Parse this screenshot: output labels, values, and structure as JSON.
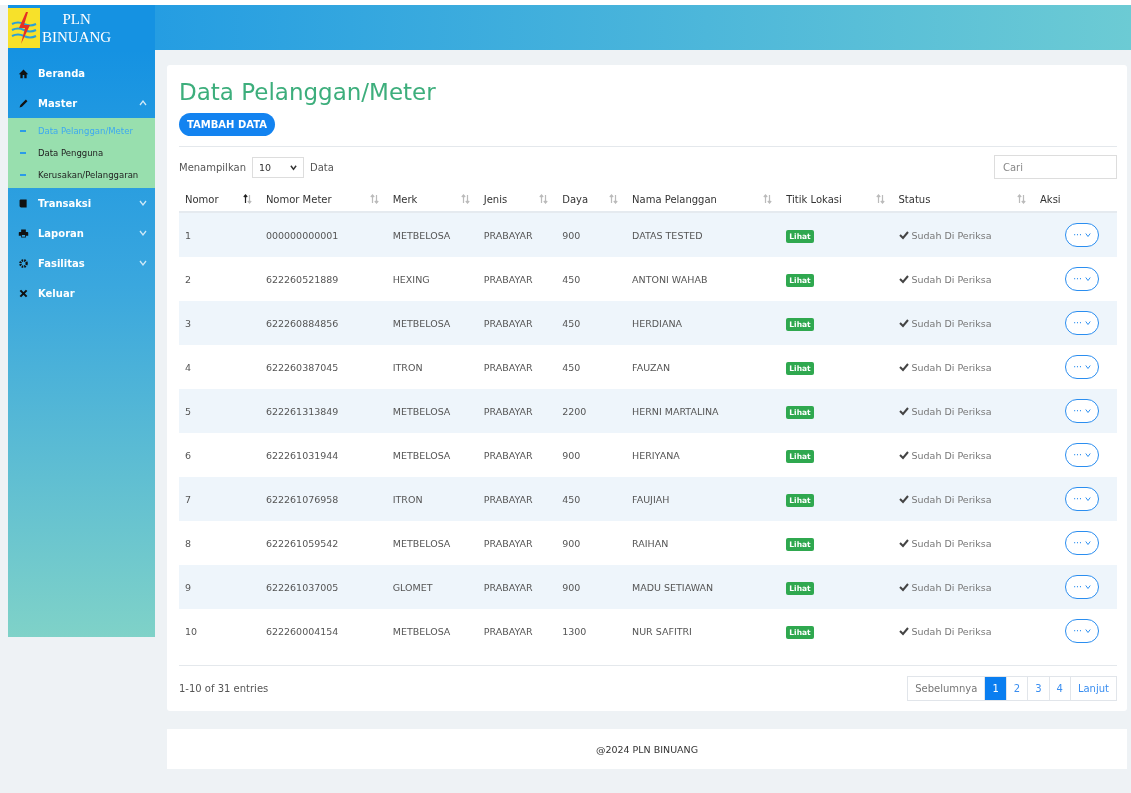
{
  "brand": {
    "line1": "PLN",
    "line2": "BINUANG"
  },
  "sidebar": {
    "items": [
      {
        "label": "Beranda",
        "selected": false
      },
      {
        "label": "Master",
        "expanded": true,
        "selected": false,
        "children": [
          {
            "label": "Data Pelanggan/Meter",
            "selected": true
          },
          {
            "label": "Data Pengguna",
            "selected": false
          },
          {
            "label": "Kerusakan/Pelanggaran",
            "selected": false
          }
        ]
      },
      {
        "label": "Transaksi",
        "expanded": false,
        "selected": false
      },
      {
        "label": "Laporan",
        "expanded": false,
        "selected": false
      },
      {
        "label": "Fasilitas",
        "expanded": false,
        "selected": false
      },
      {
        "label": "Keluar",
        "selected": false
      }
    ]
  },
  "page": {
    "title": "Data Pelanggan/Meter",
    "add_button": "TAMBAH DATA"
  },
  "table": {
    "show_label": "Menampilkan",
    "page_size": "10",
    "show_suffix": "Data",
    "search": {
      "placeholder": "Cari"
    },
    "columns": [
      {
        "label": "Nomor",
        "sorted": true
      },
      {
        "label": "Nomor Meter",
        "sorted": false
      },
      {
        "label": "Merk",
        "sorted": false
      },
      {
        "label": "Jenis",
        "sorted": false
      },
      {
        "label": "Daya",
        "sorted": false
      },
      {
        "label": "Nama Pelanggan",
        "sorted": false
      },
      {
        "label": "Titik Lokasi",
        "sorted": false
      },
      {
        "label": "Status",
        "sorted": false
      },
      {
        "label": "Aksi"
      }
    ],
    "rows": [
      {
        "nomor": "1",
        "meter": "000000000001",
        "merk": "METBELOSA",
        "jenis": "PRABAYAR",
        "daya": "900",
        "nama": "DATAS TESTED",
        "lokasi": "Lihat",
        "status": "Sudah Di Periksa",
        "aksi": "···"
      },
      {
        "nomor": "2",
        "meter": "622260521889",
        "merk": "HEXING",
        "jenis": "PRABAYAR",
        "daya": "450",
        "nama": "ANTONI WAHAB",
        "lokasi": "Lihat",
        "status": "Sudah Di Periksa",
        "aksi": "···"
      },
      {
        "nomor": "3",
        "meter": "622260884856",
        "merk": "METBELOSA",
        "jenis": "PRABAYAR",
        "daya": "450",
        "nama": "HERDIANA",
        "lokasi": "Lihat",
        "status": "Sudah Di Periksa",
        "aksi": "···"
      },
      {
        "nomor": "4",
        "meter": "622260387045",
        "merk": "ITRON",
        "jenis": "PRABAYAR",
        "daya": "450",
        "nama": "FAUZAN",
        "lokasi": "Lihat",
        "status": "Sudah Di Periksa",
        "aksi": "···"
      },
      {
        "nomor": "5",
        "meter": "622261313849",
        "merk": "METBELOSA",
        "jenis": "PRABAYAR",
        "daya": "2200",
        "nama": "HERNI MARTALINA",
        "lokasi": "Lihat",
        "status": "Sudah Di Periksa",
        "aksi": "···"
      },
      {
        "nomor": "6",
        "meter": "622261031944",
        "merk": "METBELOSA",
        "jenis": "PRABAYAR",
        "daya": "900",
        "nama": "HERIYANA",
        "lokasi": "Lihat",
        "status": "Sudah Di Periksa",
        "aksi": "···"
      },
      {
        "nomor": "7",
        "meter": "622261076958",
        "merk": "ITRON",
        "jenis": "PRABAYAR",
        "daya": "450",
        "nama": "FAUJIAH",
        "lokasi": "Lihat",
        "status": "Sudah Di Periksa",
        "aksi": "···"
      },
      {
        "nomor": "8",
        "meter": "622261059542",
        "merk": "METBELOSA",
        "jenis": "PRABAYAR",
        "daya": "900",
        "nama": "RAIHAN",
        "lokasi": "Lihat",
        "status": "Sudah Di Periksa",
        "aksi": "···"
      },
      {
        "nomor": "9",
        "meter": "622261037005",
        "merk": "GLOMET",
        "jenis": "PRABAYAR",
        "daya": "900",
        "nama": "MADU SETIAWAN",
        "lokasi": "Lihat",
        "status": "Sudah Di Periksa",
        "aksi": "···"
      },
      {
        "nomor": "10",
        "meter": "622260004154",
        "merk": "METBELOSA",
        "jenis": "PRABAYAR",
        "daya": "1300",
        "nama": "NUR SAFITRI",
        "lokasi": "Lihat",
        "status": "Sudah Di Periksa",
        "aksi": "···"
      }
    ],
    "info": "1-10 of 31 entries",
    "pagination": {
      "prev": "Sebelumnya",
      "next": "Lanjut",
      "pages": [
        {
          "label": "1",
          "selected": true
        },
        {
          "label": "2",
          "selected": false
        },
        {
          "label": "3",
          "selected": false
        },
        {
          "label": "4",
          "selected": false
        }
      ]
    }
  },
  "footer": "@2024 PLN BINUANG"
}
